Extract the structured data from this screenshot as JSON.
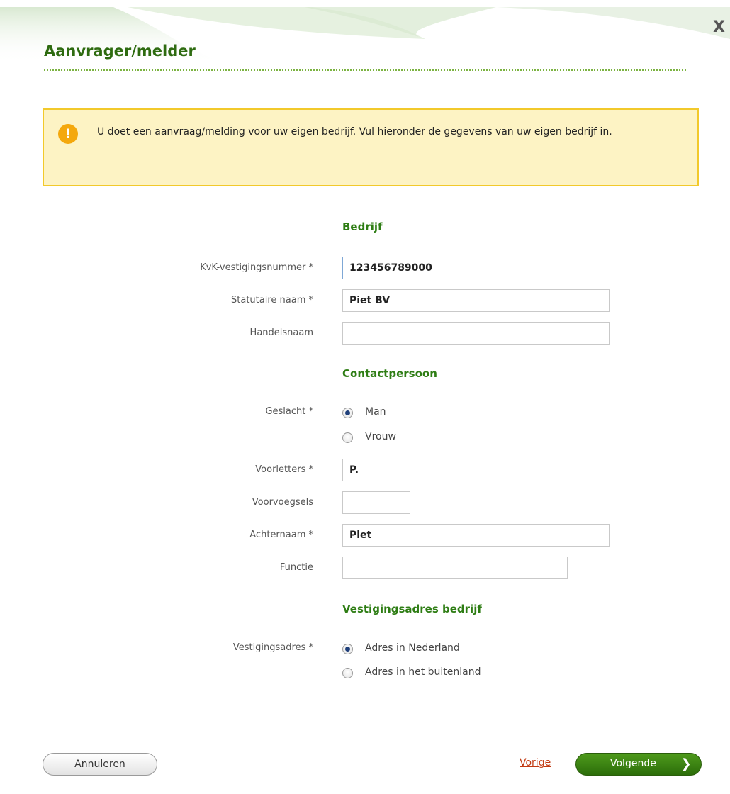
{
  "dialog": {
    "title": "Aanvrager/melder",
    "close_label": "X"
  },
  "notice": {
    "icon": "exclamation-icon",
    "icon_glyph": "!",
    "text": "U doet een aanvraag/melding voor uw eigen bedrijf. Vul hieronder de gegevens van uw eigen bedrijf in."
  },
  "company": {
    "heading": "Bedrijf",
    "kvk_label": "KvK-vestigingsnummer *",
    "kvk_value": "123456789000",
    "statutory_label": "Statutaire naam *",
    "statutory_value": "Piet BV",
    "trade_label": "Handelsnaam",
    "trade_value": ""
  },
  "contact": {
    "heading": "Contactpersoon",
    "gender_label": "Geslacht *",
    "gender_options": [
      "Man",
      "Vrouw"
    ],
    "gender_selected": "Man",
    "initials_label": "Voorletters *",
    "initials_value": "P.",
    "prefix_label": "Voorvoegsels",
    "prefix_value": "",
    "surname_label": "Achternaam *",
    "surname_value": "Piet",
    "function_label": "Functie",
    "function_value": ""
  },
  "address": {
    "heading": "Vestigingsadres bedrijf",
    "label": "Vestigingsadres *",
    "options": [
      "Adres in Nederland",
      "Adres in het buitenland"
    ],
    "selected": "Adres in Nederland"
  },
  "footer": {
    "cancel_label": "Annuleren",
    "previous_label": "Vorige",
    "next_label": "Volgende",
    "next_icon": "chevron-right-icon",
    "next_glyph": "❯"
  },
  "colors": {
    "accent_green": "#2e7d14",
    "notice_bg": "#fdf3c4",
    "notice_border": "#f2c92b",
    "link_red": "#c23a12"
  }
}
